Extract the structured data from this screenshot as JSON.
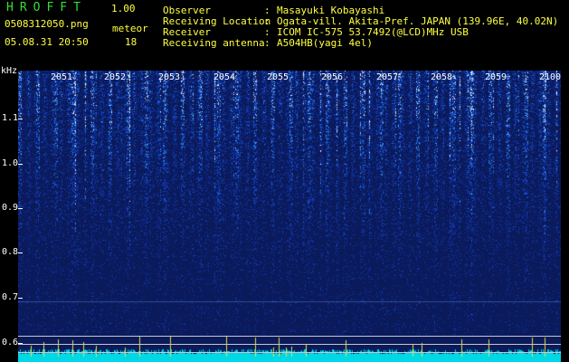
{
  "header": {
    "app_title": "HROFFT",
    "version": "1.00",
    "file_name": "0508312050.png",
    "mode": "meteor",
    "datetime": "05.08.31 20:50",
    "count": "18"
  },
  "info": [
    {
      "label": "Observer",
      "value": "Masayuki Kobayashi"
    },
    {
      "label": "Receiving Location",
      "value": "Ogata-vill. Akita-Pref. JAPAN (139.96E, 40.02N)"
    },
    {
      "label": "Receiver",
      "value": "ICOM IC-575 53.7492(@LCD)MHz USB"
    },
    {
      "label": "Receiving antenna",
      "value": "A504HB(yagi 4el)"
    }
  ],
  "axis": {
    "unit": "kHz",
    "y_ticks": [
      "1.1",
      "1.0",
      "0.9",
      "0.8",
      "0.7",
      "0.6"
    ],
    "time_labels": [
      "2051",
      "2052",
      "2053",
      "2054",
      "2055",
      "2056",
      "2057",
      "2058",
      "2059",
      "2100"
    ]
  },
  "colors": {
    "header_green": "#33e033",
    "header_yellow": "#ffff44",
    "signal_cyan": "#00d8e8",
    "peak_yellow": "#e8e040",
    "background_blue": "#0a1a5a"
  }
}
